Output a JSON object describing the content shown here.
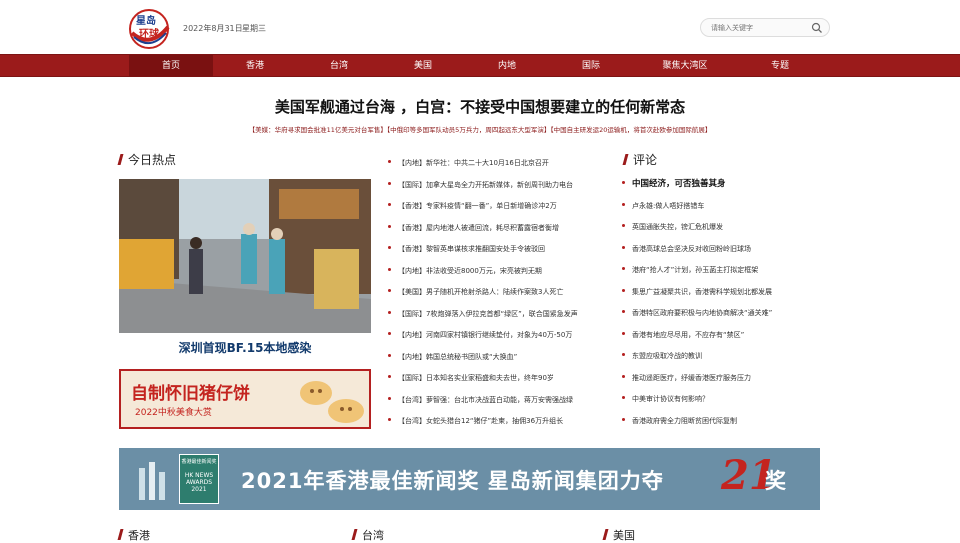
{
  "header": {
    "logo_text": "星岛环球",
    "date": "2022年8月31日",
    "weekday": "星期三",
    "search_placeholder": "请输入关键字"
  },
  "nav": {
    "items": [
      "首页",
      "香港",
      "台湾",
      "美国",
      "内地",
      "国际",
      "聚焦大湾区",
      "专题"
    ],
    "active": "首页"
  },
  "headline": "美国军舰通过台海 ，白宫：不接受中国想要建立的任何新常态",
  "subheadlines": "【美媒：华府寻求国会批准11亿美元对台军售】【中俄印等多国军队动员5万兵力，周四起远东大型军演】【中国自主研发运20运输机，将首次赴欧参加国际航展】",
  "hot": {
    "title": "今日热点",
    "photo_caption": "深圳首现BF.15本地感染",
    "promo_title": "自制怀旧猪仔饼",
    "promo_sub": "2022中秋美食大赏",
    "news": [
      "【内地】新华社：中共二十大10月16日北京召开",
      "【国际】加拿大星岛全力开拓新媒体，新创周刊助力电台",
      "【香港】专家料疫情“翻一番”，单日新增确诊冲2万",
      "【香港】屋内地港人被遣回流，耗尽积蓄露宿者衡增",
      "【香港】黎智英串谋核求推翻国安处手令被驳回",
      "【内地】非法收受近8000万元，宋亮被判无期",
      "【美国】男子随机开枪射杀路人：陆续作案致3人死亡",
      "【国际】7枚炮弹落入伊拉克首都“绿区”，联合国紧急发声",
      "【内地】河南四家村镇银行继续垫付，对象为40万-50万",
      "【内地】韩国总统秘书团队或“大换血”",
      "【国际】日本知名实业家稻盛和夫去世，终年90岁",
      "【台湾】萝智强：台北市决战蓝白动能，蒋万安需强战绿",
      "【台湾】女蛇头猎台12“猪仔”赴柬，抽佣36万升组长"
    ]
  },
  "comment": {
    "title": "评论",
    "items": [
      "中国经济，可否独善其身",
      "卢永雄:做人唔好搭错车",
      "英国通胀失控，镑汇危机爆发",
      "香港高球总会坚决反对收回粉岭旧球场",
      "港府“抢人才”计划，孙玉菡主打拟定框架",
      "集思广益凝聚共识，香港需科学规划北都发展",
      "香港特区政府要积极与内地协商解决“通关难”",
      "香港有地应尽尽用，不应存有“禁区”",
      "东盟应吸取冷战的教训",
      "推动遥距医疗，纾缓香港医疗服务压力",
      "中美审计协议有何影响？",
      "香港政府需全力阻断贫困代际复制"
    ]
  },
  "banner": {
    "text": "2021年香港最佳新闻奖  星岛新闻集团力夺",
    "number": "21",
    "suffix": "奖",
    "awards_label_1": "香港最佳新闻奖",
    "awards_label_2": "HK NEWS",
    "awards_label_3": "AWARDS",
    "awards_label_4": "2021"
  },
  "bottom_sections": [
    "香港",
    "台湾",
    "美国"
  ],
  "colors": {
    "brand_red": "#9b1b1b",
    "active_nav": "#7a1111",
    "caption_blue": "#123a6c"
  }
}
